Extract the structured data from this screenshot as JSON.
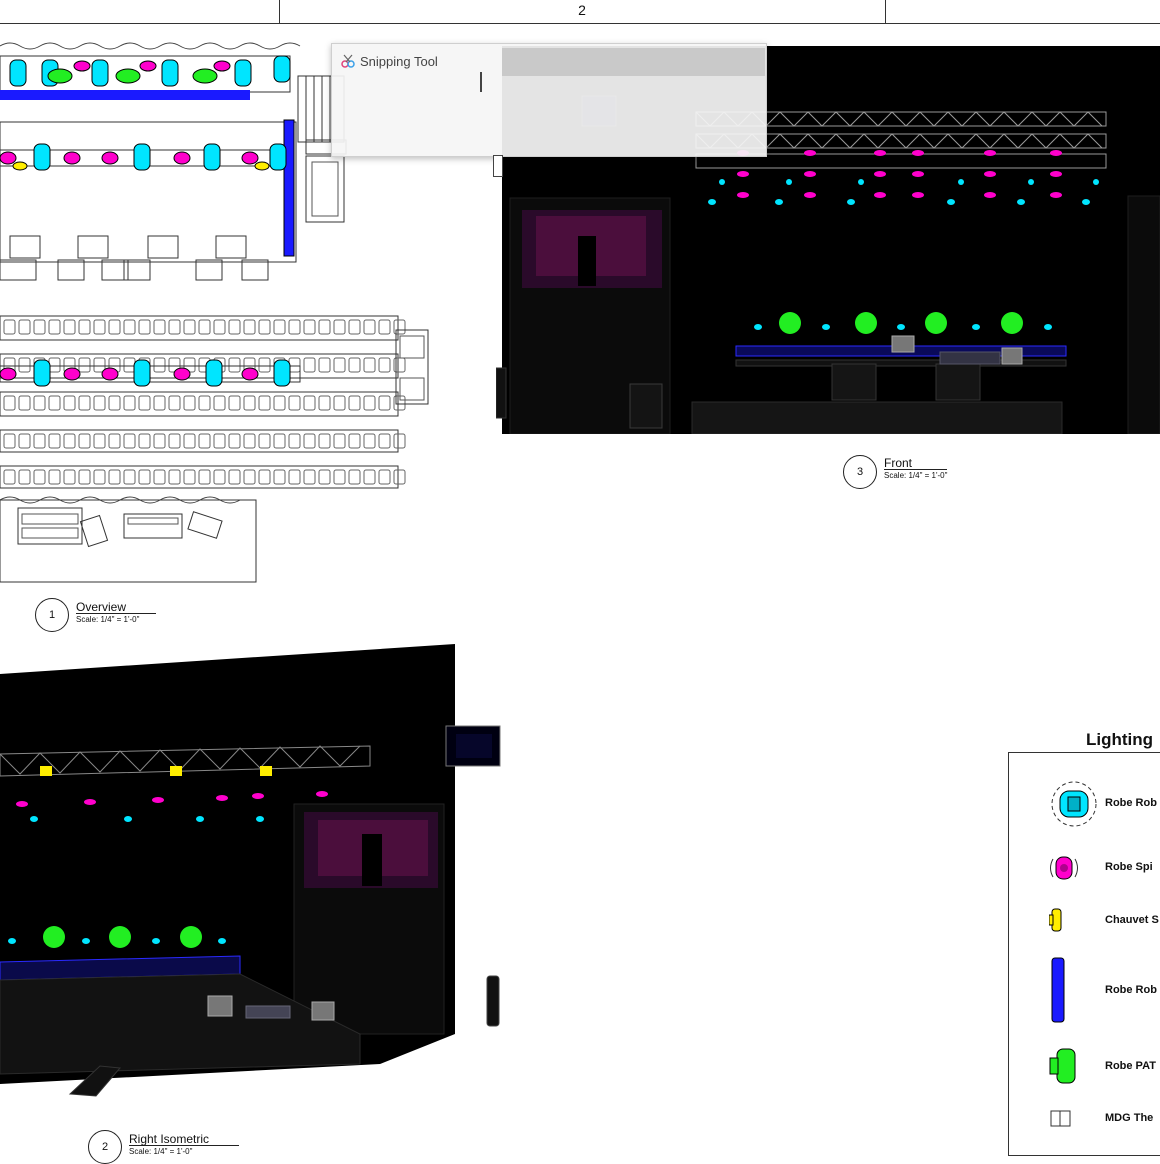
{
  "sheet": {
    "number": "2"
  },
  "snipping_tool": {
    "title": "Snipping Tool"
  },
  "views": {
    "overview": {
      "number": "1",
      "title": "Overview",
      "scale": "Scale: 1/4\" = 1'-0\""
    },
    "front": {
      "number": "3",
      "title": "Front",
      "scale": "Scale: 1/4\" = 1'-0\""
    },
    "right_iso": {
      "number": "2",
      "title": "Right Isometric",
      "scale": "Scale: 1/4\" = 1'-0\""
    }
  },
  "legend": {
    "title": "Lighting",
    "items": [
      {
        "label": "Robe Rob",
        "icon": "robe-spot-icon",
        "color": "#00e5ff"
      },
      {
        "label": "Robe Spi",
        "icon": "robe-spiider-icon",
        "color": "#ff00cc"
      },
      {
        "label": "Chauvet S",
        "icon": "chauvet-icon",
        "color": "#ffee00"
      },
      {
        "label": "Robe Rob",
        "icon": "robe-batten-icon",
        "color": "#1a1aff"
      },
      {
        "label": "Robe PAT",
        "icon": "robe-pat-icon",
        "color": "#22ee22"
      },
      {
        "label": "MDG The",
        "icon": "mdg-hazer-icon",
        "color": "#ffffff"
      }
    ]
  },
  "colors": {
    "cyan": "#00e5ff",
    "magenta": "#ff00cc",
    "yellow": "#ffee00",
    "blue": "#1a1aff",
    "green": "#22ee22"
  }
}
